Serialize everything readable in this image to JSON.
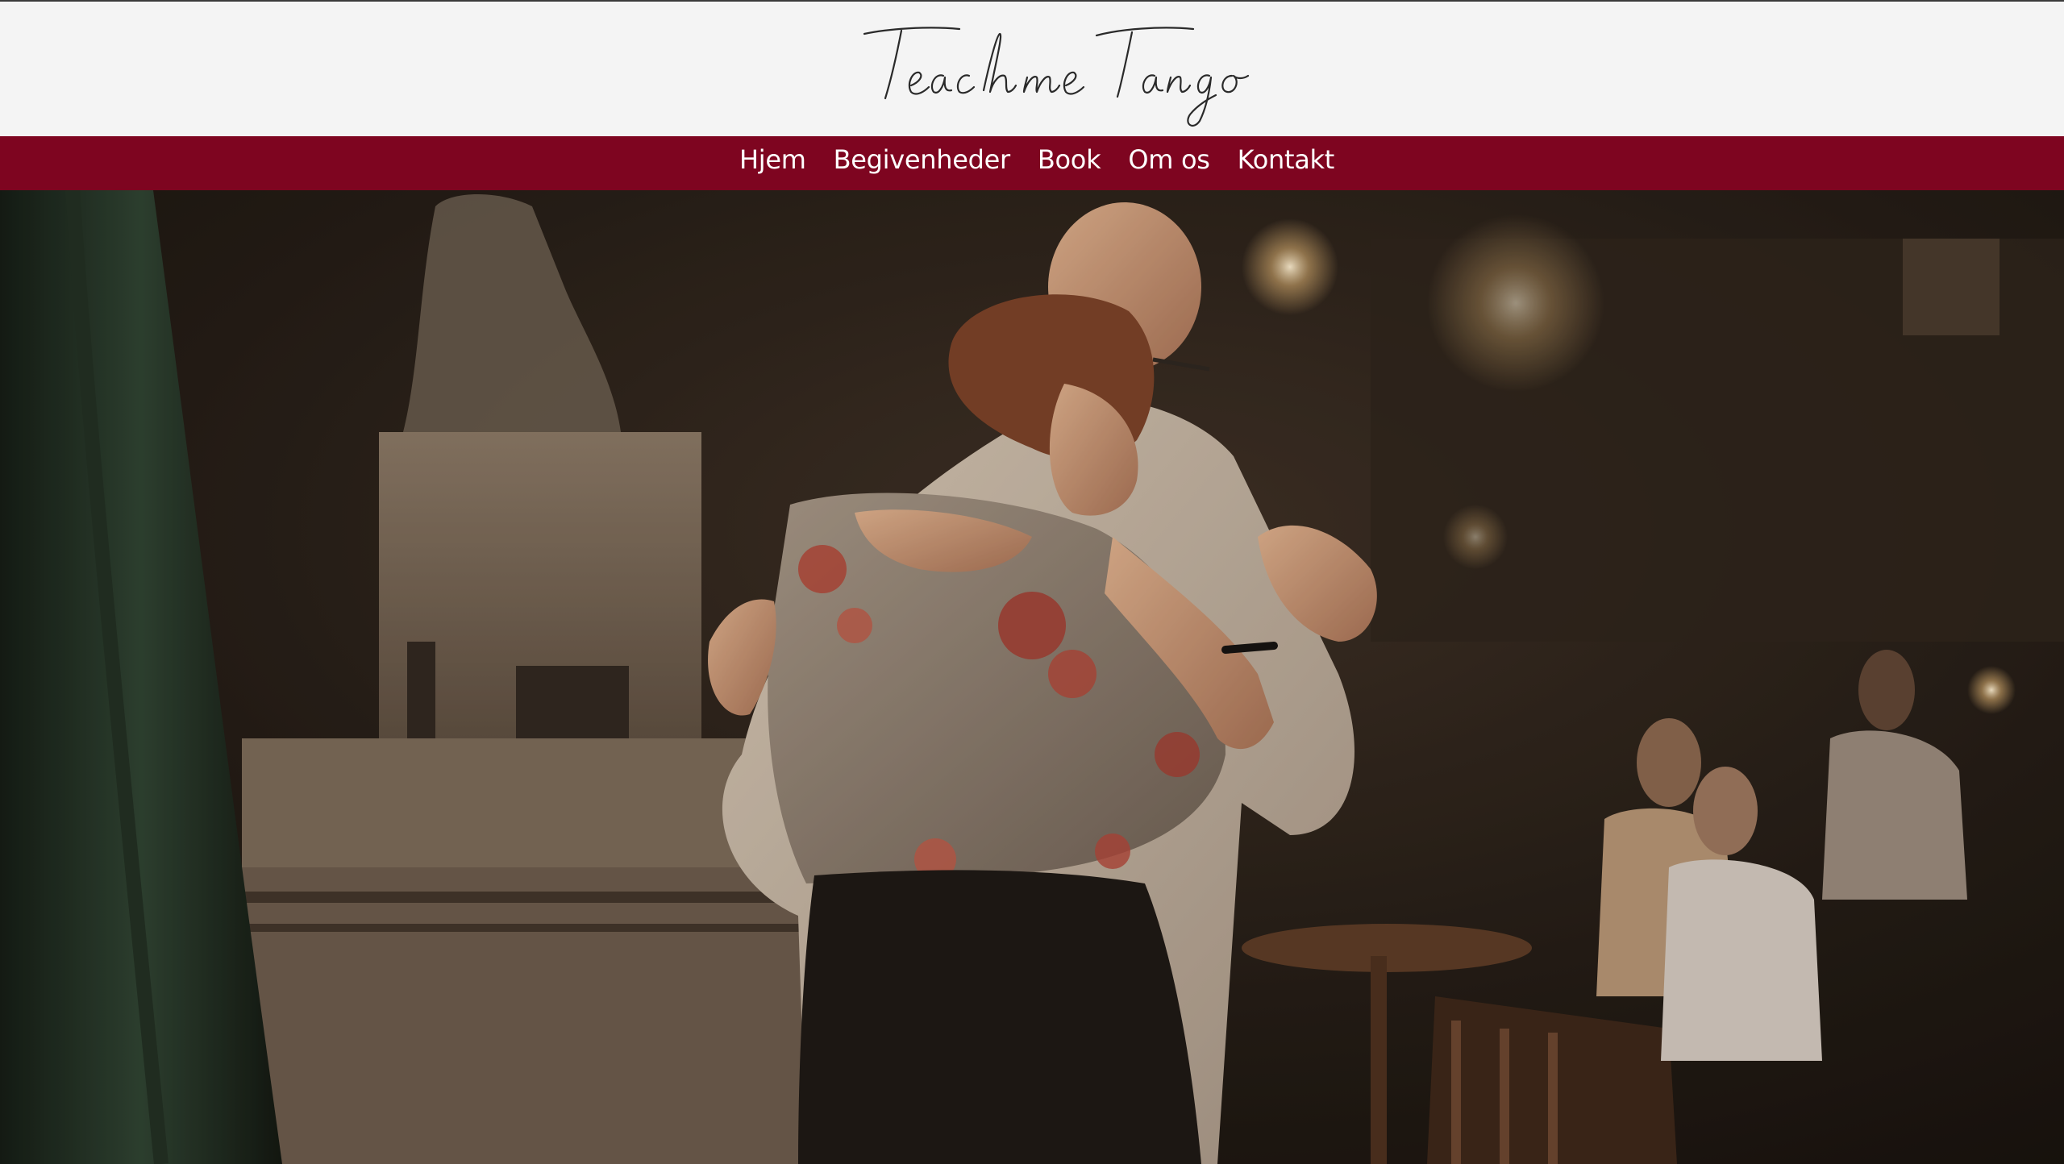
{
  "brand": {
    "logo_text": "Teach me Tango",
    "logo_icon": "script-signature-logo"
  },
  "nav": {
    "items": [
      {
        "label": "Hjem"
      },
      {
        "label": "Begivenheder"
      },
      {
        "label": "Book"
      },
      {
        "label": "Om os"
      },
      {
        "label": "Kontakt"
      }
    ]
  },
  "hero": {
    "image": "tango-couple-dancing-photo"
  },
  "colors": {
    "header_bg": "#f4f4f4",
    "nav_bg": "#7e0520",
    "nav_text": "#ffffff",
    "logo_ink": "#2a2a2a"
  }
}
